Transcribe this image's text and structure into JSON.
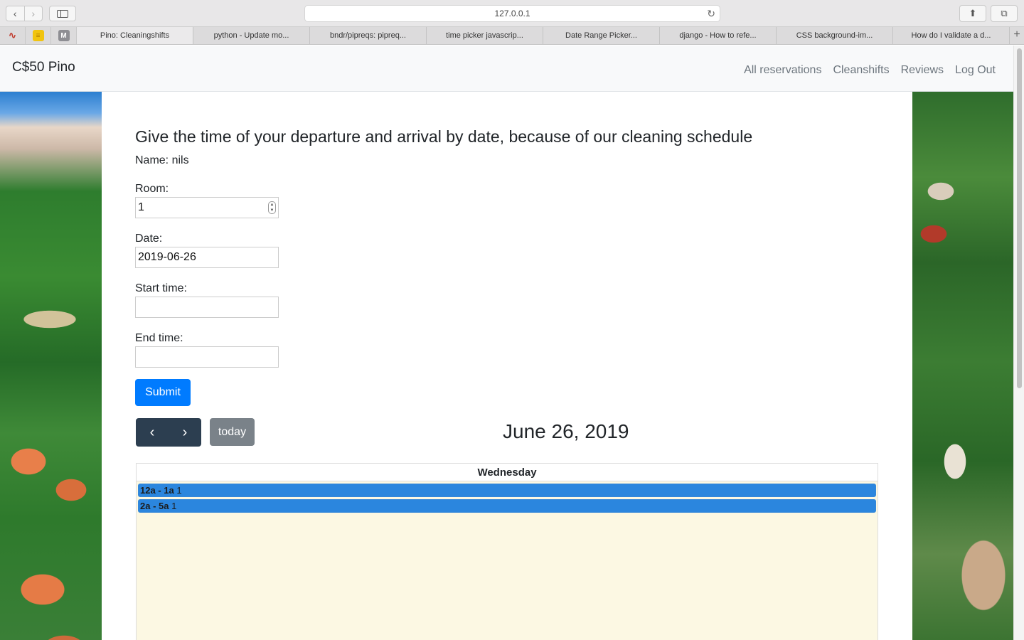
{
  "browser": {
    "url": "127.0.0.1",
    "tabs": [
      {
        "label": "Pino: Cleaningshifts",
        "active": true
      },
      {
        "label": "python - Update mo..."
      },
      {
        "label": "bndr/pipreqs: pipreq..."
      },
      {
        "label": "time picker javascrip..."
      },
      {
        "label": "Date Range Picker..."
      },
      {
        "label": "django - How to refe..."
      },
      {
        "label": "CSS background-im..."
      },
      {
        "label": "How do I validate a d..."
      }
    ],
    "pinned": [
      {
        "icon": "wave-icon",
        "color": "#c0392b"
      },
      {
        "icon": "notes-icon",
        "color": "#f1c40f"
      },
      {
        "icon": "m-icon",
        "color": "#8e8e93",
        "letter": "M"
      }
    ]
  },
  "navbar": {
    "brand": "C$50 Pino",
    "links": [
      "All reservations",
      "Cleanshifts",
      "Reviews",
      "Log Out"
    ]
  },
  "form": {
    "heading": "Give the time of your departure and arrival by date, because of our cleaning schedule",
    "name_line": "Name: nils",
    "room_label": "Room:",
    "room_value": "1",
    "date_label": "Date:",
    "date_value": "2019-06-26",
    "start_label": "Start time:",
    "start_value": "",
    "end_label": "End time:",
    "end_value": "",
    "submit_label": "Submit"
  },
  "calendar": {
    "today_label": "today",
    "title": "June 26, 2019",
    "day_header": "Wednesday",
    "events": [
      {
        "time": "12a - 1a",
        "title": "1"
      },
      {
        "time": "2a - 5a",
        "title": "1"
      }
    ],
    "colors": {
      "event": "#2b86de",
      "background": "#fcf8e3",
      "nav": "#2c3e50",
      "submit": "#007bff"
    }
  }
}
